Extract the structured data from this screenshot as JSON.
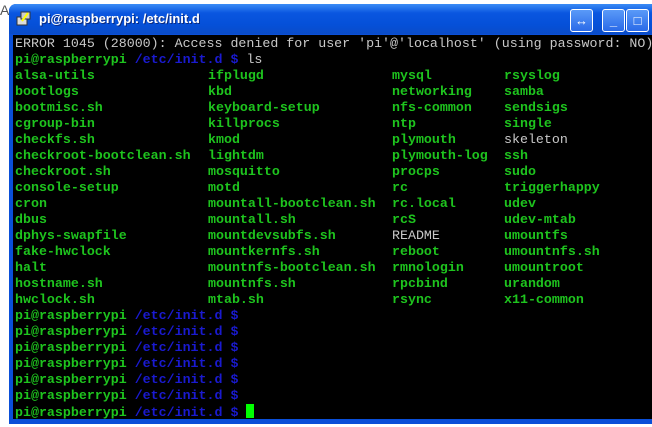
{
  "window": {
    "title": "pi@raspberrypi: /etc/init.d"
  },
  "terminal": {
    "error_line": "ERROR 1045 (28000): Access denied for user 'pi'@'localhost' (using password: NO)",
    "prompt_user": "pi@raspberrypi",
    "prompt_path": "/etc/init.d",
    "prompt_symbol": "$",
    "command": "ls",
    "ls_rows": [
      [
        "alsa-utils",
        "ifplugd",
        "mysql",
        "rsyslog"
      ],
      [
        "bootlogs",
        "kbd",
        "networking",
        "samba"
      ],
      [
        "bootmisc.sh",
        "keyboard-setup",
        "nfs-common",
        "sendsigs"
      ],
      [
        "cgroup-bin",
        "killprocs",
        "ntp",
        "single"
      ],
      [
        "checkfs.sh",
        "kmod",
        "plymouth",
        "skeleton"
      ],
      [
        "checkroot-bootclean.sh",
        "lightdm",
        "plymouth-log",
        "ssh"
      ],
      [
        "checkroot.sh",
        "mosquitto",
        "procps",
        "sudo"
      ],
      [
        "console-setup",
        "motd",
        "rc",
        "triggerhappy"
      ],
      [
        "cron",
        "mountall-bootclean.sh",
        "rc.local",
        "udev"
      ],
      [
        "dbus",
        "mountall.sh",
        "rcS",
        "udev-mtab"
      ],
      [
        "dphys-swapfile",
        "mountdevsubfs.sh",
        "README",
        "umountfs"
      ],
      [
        "fake-hwclock",
        "mountkernfs.sh",
        "reboot",
        "umountnfs.sh"
      ],
      [
        "halt",
        "mountnfs-bootclean.sh",
        "rmnologin",
        "umountroot"
      ],
      [
        "hostname.sh",
        "mountnfs.sh",
        "rpcbind",
        "urandom"
      ],
      [
        "hwclock.sh",
        "mtab.sh",
        "rsync",
        "x11-common"
      ]
    ],
    "plain_files": [
      "skeleton",
      "README"
    ],
    "empty_prompts": 7
  },
  "colors": {
    "executable": "#1ec41e",
    "path": "#1a1ad0",
    "plain": "#c8c8c8",
    "background": "#000000"
  }
}
